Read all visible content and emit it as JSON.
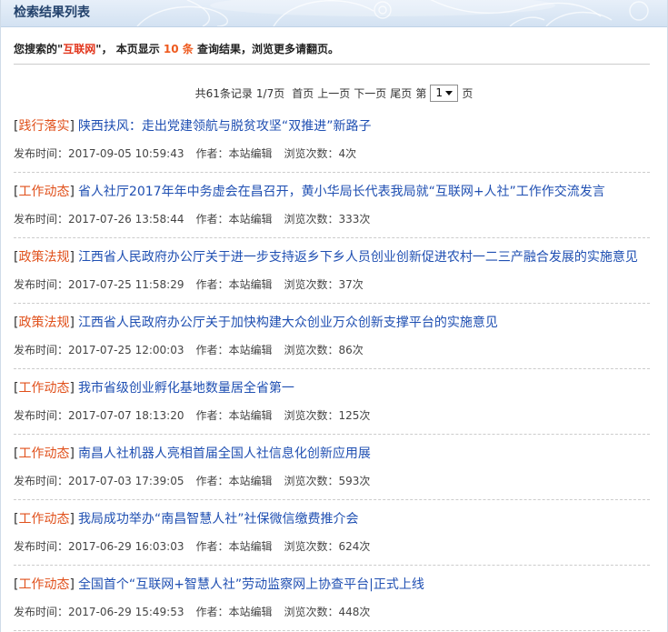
{
  "header": {
    "title": "检索结果列表"
  },
  "summary": {
    "prefix": "您搜索的",
    "quote_open": "\"",
    "keyword": "互联网",
    "quote_close": "\"",
    "middle": "， 本页显示 ",
    "count": "10 条",
    "suffix": " 查询结果，浏览更多请翻页。"
  },
  "pagination": {
    "total": "共61条记录",
    "page_info": "1/7页",
    "first": "首页",
    "prev": "上一页",
    "next": "下一页",
    "last": "尾页",
    "goto_prefix": "第",
    "current_page": "1",
    "goto_suffix": "页"
  },
  "list_format": {
    "bracket_open": "[",
    "bracket_close": "]"
  },
  "meta_labels": {
    "published": "发布时间：",
    "author": "作者：",
    "views": "浏览次数："
  },
  "results": [
    {
      "category": "践行落实",
      "title": "陕西扶风：走出党建领航与脱贫攻坚“双推进”新路子",
      "published": "2017-09-05 10:59:43",
      "author": "本站编辑",
      "views": "4次"
    },
    {
      "category": "工作动态",
      "title": "省人社厅2017年年中务虚会在昌召开，黄小华局长代表我局就“互联网+人社”工作作交流发言",
      "published": "2017-07-26 13:58:44",
      "author": "本站编辑",
      "views": "333次"
    },
    {
      "category": "政策法规",
      "title": "江西省人民政府办公厅关于进一步支持返乡下乡人员创业创新促进农村一二三产融合发展的实施意见",
      "published": "2017-07-25 11:58:29",
      "author": "本站编辑",
      "views": "37次"
    },
    {
      "category": "政策法规",
      "title": "江西省人民政府办公厅关于加快构建大众创业万众创新支撑平台的实施意见",
      "published": "2017-07-25 12:00:03",
      "author": "本站编辑",
      "views": "86次"
    },
    {
      "category": "工作动态",
      "title": "我市省级创业孵化基地数量居全省第一",
      "published": "2017-07-07 18:13:20",
      "author": "本站编辑",
      "views": "125次"
    },
    {
      "category": "工作动态",
      "title": "南昌人社机器人亮相首届全国人社信息化创新应用展",
      "published": "2017-07-03 17:39:05",
      "author": "本站编辑",
      "views": "593次"
    },
    {
      "category": "工作动态",
      "title": "我局成功举办“南昌智慧人社”社保微信缴费推介会",
      "published": "2017-06-29 16:03:03",
      "author": "本站编辑",
      "views": "624次"
    },
    {
      "category": "工作动态",
      "title": "全国首个“互联网+智慧人社”劳动监察网上协查平台|正式上线",
      "published": "2017-06-29 15:49:53",
      "author": "本站编辑",
      "views": "448次"
    }
  ],
  "icons": {
    "page_select_arrow": "chevron-down-icon"
  },
  "colors": {
    "header_bg_top": "#e7eff9",
    "header_bg_bottom": "#d3e2f2",
    "header_text": "#23426c",
    "frame_border": "#cfdbe8",
    "keyword": "#e2361d",
    "count": "#ee5a1e",
    "category": "#e0501b",
    "title_link": "#1f4fb2",
    "meta_text": "#444444",
    "separator": "#cccccc"
  }
}
